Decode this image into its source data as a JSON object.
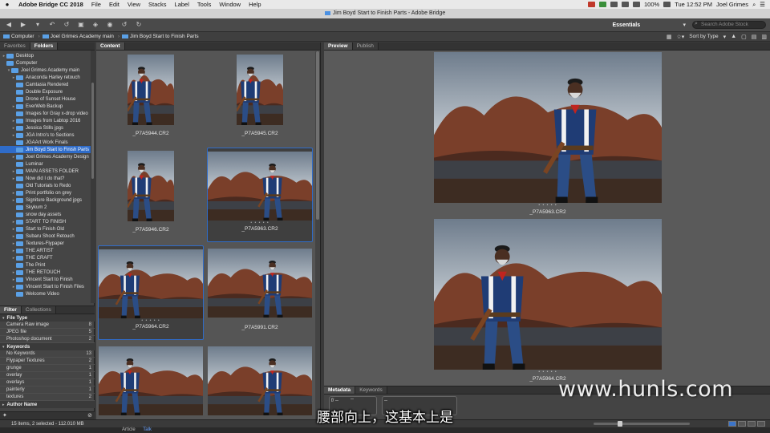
{
  "menubar": {
    "app_name": "Adobe Bridge CC 2018",
    "items": [
      "File",
      "Edit",
      "View",
      "Stacks",
      "Label",
      "Tools",
      "Window",
      "Help"
    ],
    "battery": "100%",
    "time": "Tue 12:52 PM",
    "user": "Joel Grimes"
  },
  "window": {
    "title": "Jim Boyd Start to Finish Parts - Adobe Bridge"
  },
  "toolbar": {
    "workspace": "Essentials",
    "search_placeholder": "Search Adobe Stock"
  },
  "path": {
    "crumbs": [
      "Computer",
      "Joel Grimes Academy main",
      "Jim Boyd Start to Finish Parts"
    ],
    "sort_label": "Sort by Type"
  },
  "left_tabs": [
    "Favorites",
    "Folders"
  ],
  "folders": [
    {
      "label": "Desktop",
      "indent": 1,
      "tw": "▸"
    },
    {
      "label": "Computer",
      "indent": 1,
      "tw": ""
    },
    {
      "label": "Joel Grimes Academy main",
      "indent": 2,
      "tw": "▾"
    },
    {
      "label": "Anaconda Harley retouch",
      "indent": 3,
      "tw": "▸"
    },
    {
      "label": "Camtasia Rendered",
      "indent": 3,
      "tw": ""
    },
    {
      "label": "Double Exposure",
      "indent": 3,
      "tw": ""
    },
    {
      "label": "Drone of Sunset House",
      "indent": 3,
      "tw": ""
    },
    {
      "label": "EverWeb Backup",
      "indent": 3,
      "tw": "▸"
    },
    {
      "label": "Images for Gray x-drop video",
      "indent": 3,
      "tw": ""
    },
    {
      "label": "Images from Labtop 2016",
      "indent": 3,
      "tw": "▸"
    },
    {
      "label": "Jessica Stills jpgs",
      "indent": 3,
      "tw": "▸"
    },
    {
      "label": "JGA Intro's to Sections",
      "indent": 3,
      "tw": "▸"
    },
    {
      "label": "JGAArt Work Finals",
      "indent": 3,
      "tw": ""
    },
    {
      "label": "Jim Boyd Start to Finish Parts",
      "indent": 3,
      "tw": "",
      "selected": true
    },
    {
      "label": "Joel Grimes Academy Design",
      "indent": 3,
      "tw": "▸"
    },
    {
      "label": "Luminar",
      "indent": 3,
      "tw": ""
    },
    {
      "label": "MAIN ASSETS FOLDER",
      "indent": 3,
      "tw": "▸"
    },
    {
      "label": "Now did I do that?",
      "indent": 3,
      "tw": "▸"
    },
    {
      "label": "Old Tutorials to Redo",
      "indent": 3,
      "tw": ""
    },
    {
      "label": "Print portfolio on grey",
      "indent": 3,
      "tw": "▸"
    },
    {
      "label": "Signiture Background jpgs",
      "indent": 3,
      "tw": "▸"
    },
    {
      "label": "Skykum 2",
      "indent": 3,
      "tw": ""
    },
    {
      "label": "snow day assets",
      "indent": 3,
      "tw": ""
    },
    {
      "label": "START TO FINISH",
      "indent": 3,
      "tw": "▸"
    },
    {
      "label": "Start to Finish Old",
      "indent": 3,
      "tw": "▸"
    },
    {
      "label": "Subaru Shoot Retouch",
      "indent": 3,
      "tw": "▸"
    },
    {
      "label": "Textures-Flypaper",
      "indent": 3,
      "tw": "▸"
    },
    {
      "label": "THE ARTIST",
      "indent": 3,
      "tw": "▸"
    },
    {
      "label": "THE CRAFT",
      "indent": 3,
      "tw": "▸"
    },
    {
      "label": "The Print",
      "indent": 3,
      "tw": ""
    },
    {
      "label": "THE RETOUCH",
      "indent": 3,
      "tw": "▸"
    },
    {
      "label": "Vincent Start to Finish",
      "indent": 3,
      "tw": "▸"
    },
    {
      "label": "Vincent Start to Finish Files",
      "indent": 3,
      "tw": "▸"
    },
    {
      "label": "Welcome Video",
      "indent": 3,
      "tw": ""
    }
  ],
  "filter_tabs": [
    "Filter",
    "Collections"
  ],
  "filter": [
    {
      "category": "File Type",
      "rows": [
        {
          "label": "Camera Raw image",
          "count": "8"
        },
        {
          "label": "JPEG file",
          "count": "5"
        },
        {
          "label": "Photoshop document",
          "count": "2"
        }
      ]
    },
    {
      "category": "Keywords",
      "rows": [
        {
          "label": "No Keywords",
          "count": "13"
        },
        {
          "label": "Flypaper Textures",
          "count": "2"
        },
        {
          "label": "grunge",
          "count": "1"
        },
        {
          "label": "overlay",
          "count": "1"
        },
        {
          "label": "overlays",
          "count": "1"
        },
        {
          "label": "painterly",
          "count": "1"
        },
        {
          "label": "textures",
          "count": "2"
        }
      ]
    },
    {
      "category": "Author Name",
      "rows": []
    }
  ],
  "content_tab": "Content",
  "thumbnails": [
    {
      "name": "_P7A5944.CR2",
      "orient": "v",
      "selected": false
    },
    {
      "name": "_P7A5945.CR2",
      "orient": "v",
      "selected": false
    },
    {
      "name": "_P7A5946.CR2",
      "orient": "v",
      "selected": false
    },
    {
      "name": "_P7A5963.CR2",
      "orient": "h",
      "selected": true
    },
    {
      "name": "_P7A5964.CR2",
      "orient": "h",
      "selected": true
    },
    {
      "name": "_P7A5991.CR2",
      "orient": "h",
      "selected": false
    },
    {
      "name": "",
      "orient": "h",
      "selected": false
    },
    {
      "name": "",
      "orient": "h",
      "selected": false
    }
  ],
  "preview_tabs": [
    "Preview",
    "Publish"
  ],
  "previews": [
    {
      "name": "_P7A5963.CR2"
    },
    {
      "name": "_P7A5964.CR2"
    }
  ],
  "meta_tabs": [
    "Metadata",
    "Keywords"
  ],
  "meta": {
    "box1": "f/ --",
    "box1b": "--",
    "box2": "--"
  },
  "status": {
    "text": "15 items, 2 selected - 112.010 MB"
  },
  "dock": [
    "Article",
    "Talk"
  ],
  "watermark": "www.hunls.com",
  "subtitle": "腰部向上，这基本上是",
  "colors": {
    "selection": "#2f6cc9",
    "folder": "#5aa0e6"
  }
}
